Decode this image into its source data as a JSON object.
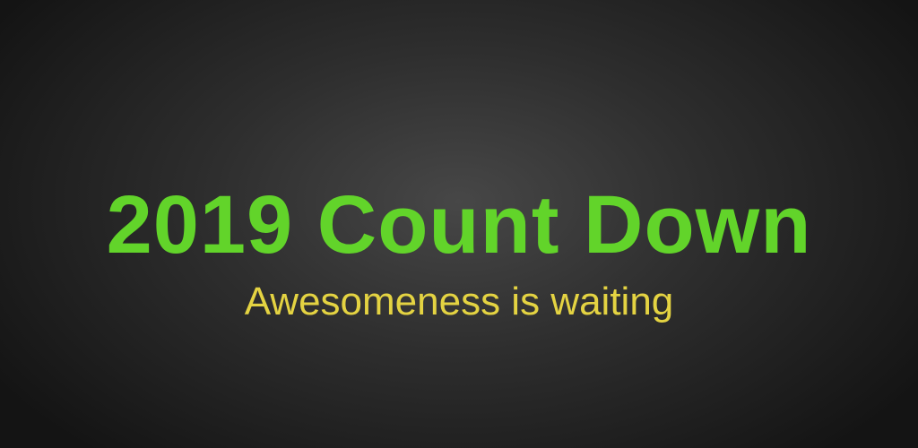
{
  "banner": {
    "title": "2019 Count Down",
    "subtitle": "Awesomeness is waiting"
  },
  "colors": {
    "title": "#62d42a",
    "subtitle": "#e4d342",
    "background_center": "#474747",
    "background_edge": "#141414"
  }
}
